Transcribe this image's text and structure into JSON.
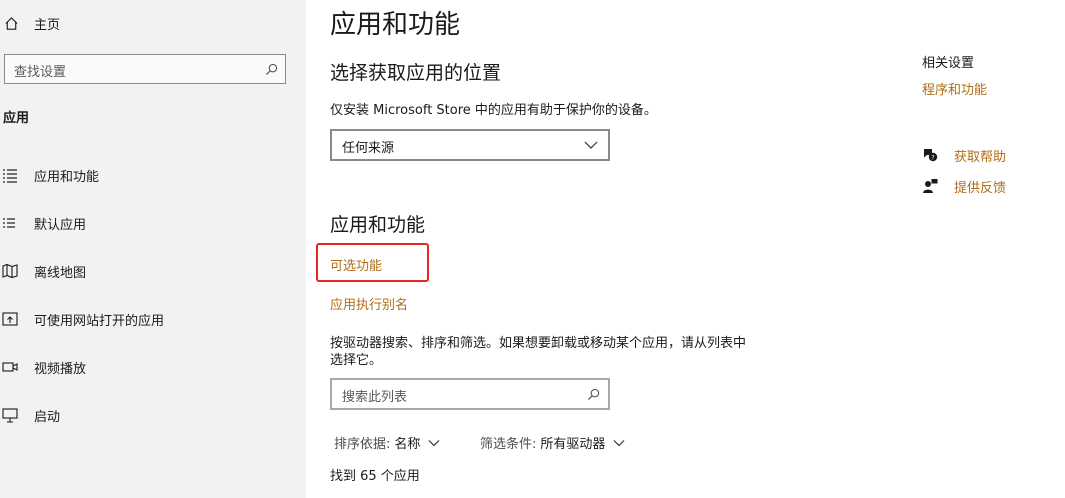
{
  "sidebar": {
    "home_label": "主页",
    "search_placeholder": "查找设置",
    "section_label": "应用",
    "items": [
      {
        "label": "应用和功能",
        "icon": "apps-features-icon"
      },
      {
        "label": "默认应用",
        "icon": "default-apps-icon"
      },
      {
        "label": "离线地图",
        "icon": "offline-maps-icon"
      },
      {
        "label": "可使用网站打开的应用",
        "icon": "apps-for-websites-icon"
      },
      {
        "label": "视频播放",
        "icon": "video-playback-icon"
      },
      {
        "label": "启动",
        "icon": "startup-icon"
      }
    ]
  },
  "main": {
    "title": "应用和功能",
    "install_section": {
      "title": "选择获取应用的位置",
      "description": "仅安装 Microsoft Store 中的应用有助于保护你的设备。",
      "dropdown_value": "任何来源"
    },
    "apps_section": {
      "title": "应用和功能",
      "optional_features_link": "可选功能",
      "app_aliases_link": "应用执行别名",
      "description_line1": "按驱动器搜索、排序和筛选。如果想要卸载或移动某个应用，请从列表中",
      "description_line2": "选择它。",
      "search_placeholder": "搜索此列表",
      "sort_label": "排序依据:",
      "sort_value": "名称",
      "filter_label": "筛选条件:",
      "filter_value": "所有驱动器",
      "result_count": "找到 65 个应用"
    }
  },
  "right_panel": {
    "related_title": "相关设置",
    "related_link": "程序和功能",
    "help_link": "获取帮助",
    "feedback_link": "提供反馈"
  },
  "colors": {
    "accent_link": "#b06d16",
    "highlight_border": "#e8261f",
    "sidebar_bg": "#f2f2f2"
  }
}
